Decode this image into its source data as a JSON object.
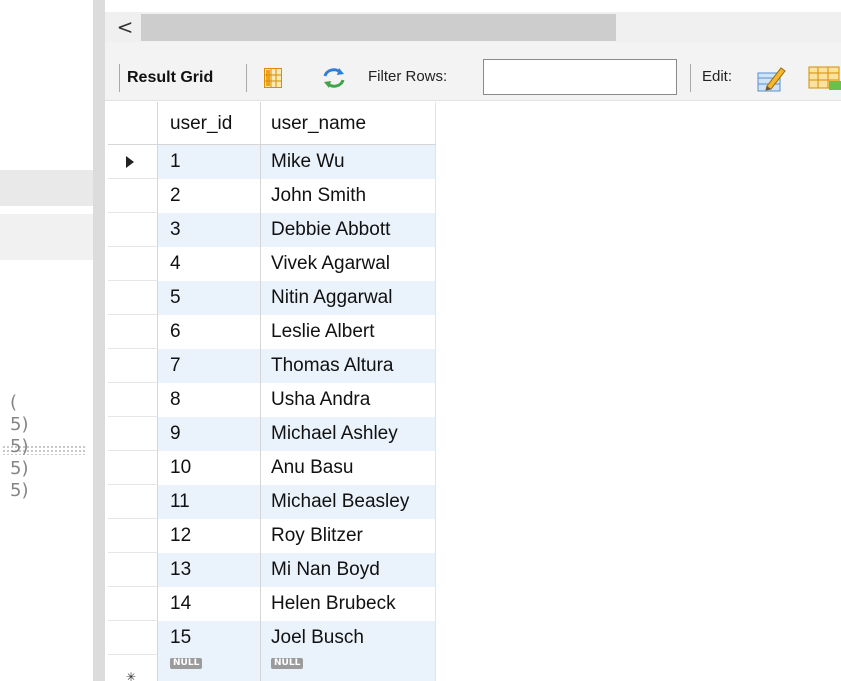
{
  "left_panel": {
    "fragments": [
      "(",
      "5)",
      "5)",
      "5)",
      "5)"
    ]
  },
  "scrollbar": {
    "left_arrow": "<"
  },
  "toolbar": {
    "result_grid_label": "Result Grid",
    "filter_label": "Filter Rows:",
    "filter_value": "",
    "edit_label": "Edit:"
  },
  "grid": {
    "columns": [
      "user_id",
      "user_name"
    ],
    "rows": [
      {
        "user_id": "1",
        "user_name": "Mike Wu"
      },
      {
        "user_id": "2",
        "user_name": "John Smith"
      },
      {
        "user_id": "3",
        "user_name": "Debbie Abbott"
      },
      {
        "user_id": "4",
        "user_name": "Vivek Agarwal"
      },
      {
        "user_id": "5",
        "user_name": "Nitin Aggarwal"
      },
      {
        "user_id": "6",
        "user_name": "Leslie Albert"
      },
      {
        "user_id": "7",
        "user_name": "Thomas Altura"
      },
      {
        "user_id": "8",
        "user_name": "Usha Andra"
      },
      {
        "user_id": "9",
        "user_name": "Michael Ashley"
      },
      {
        "user_id": "10",
        "user_name": "Anu Basu"
      },
      {
        "user_id": "11",
        "user_name": "Michael Beasley"
      },
      {
        "user_id": "12",
        "user_name": "Roy Blitzer"
      },
      {
        "user_id": "13",
        "user_name": "Mi Nan Boyd"
      },
      {
        "user_id": "14",
        "user_name": "Helen Brubeck"
      },
      {
        "user_id": "15",
        "user_name": "Joel Busch"
      }
    ],
    "new_row": {
      "user_id": "NULL",
      "user_name": "NULL"
    }
  },
  "icons": {
    "grid_layout": "grid-layout-icon",
    "refresh": "refresh-icon",
    "edit_pencil": "edit-pencil-icon",
    "table_add": "table-icon",
    "row_pointer": "row-pointer-icon",
    "new_row": "new-row-marker-icon"
  },
  "colors": {
    "alt_row": "#eaf2fb",
    "refresh_blue": "#2f7fd8",
    "grid_icon_orange": "#f0a21a",
    "null_badge": "#9b9b9b"
  }
}
